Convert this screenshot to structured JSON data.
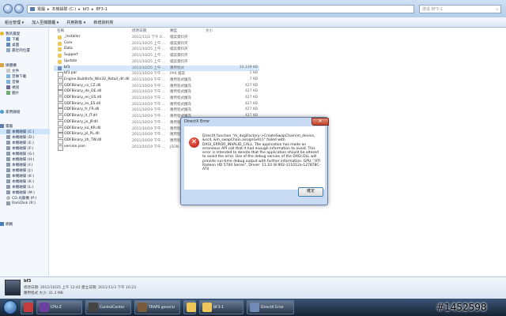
{
  "address_bar": {
    "crumbs": [
      "電腦",
      "本機磁碟 (C:)",
      "bf3",
      "BF3-1"
    ],
    "search_placeholder": "搜尋 BF3-1"
  },
  "toolbar": {
    "organize": "組合管理 ▾",
    "include_library": "加入至媒體櫃 ▾",
    "share": "共用對象 ▾",
    "new_folder": "新增資料夾"
  },
  "sidebar": {
    "favorites_header": "我的最愛",
    "favorites": [
      "下載",
      "桌面",
      "最近的位置"
    ],
    "libraries_header": "媒體櫃",
    "libraries": [
      "文件",
      "音樂下載",
      "音樂",
      "視訊",
      "圖片"
    ],
    "homegroup": "家用群組",
    "computer_header": "電腦",
    "drives": [
      "本機磁碟 (C:)",
      "本機磁碟 (D:)",
      "本機磁碟 (E:)",
      "本機磁碟 (F:)",
      "本機磁碟 (G:)",
      "本機磁碟 (H:)",
      "本機磁碟 (I:)",
      "本機磁碟 (J:)",
      "本機磁碟 (K:)",
      "本機磁碟 (K:)",
      "本機磁碟 (L:)",
      "本機磁碟 (M:)",
      "CD 光碟機 (P:)",
      "RamDisk (R:)"
    ],
    "network": "網路"
  },
  "columns": {
    "name": "名稱",
    "date": "修改日期",
    "type": "類型",
    "size": "大小"
  },
  "files": [
    {
      "name": "_Installer",
      "date": "2011/11/2 下午 0...",
      "type": "檔案資料夾",
      "size": "",
      "kind": "folder"
    },
    {
      "name": "Core",
      "date": "2011/10/25 上午 ...",
      "type": "檔案資料夾",
      "size": "",
      "kind": "folder"
    },
    {
      "name": "Data",
      "date": "2011/10/25 上午 ...",
      "type": "檔案資料夾",
      "size": "",
      "kind": "folder"
    },
    {
      "name": "Support",
      "date": "2011/10/25 上午 ...",
      "type": "檔案資料夾",
      "size": "",
      "kind": "folder"
    },
    {
      "name": "Update",
      "date": "2011/10/25 上午 ...",
      "type": "檔案資料夾",
      "size": "",
      "kind": "folder"
    },
    {
      "name": "bf3",
      "date": "2011/10/25 上午 ...",
      "type": "應用程式",
      "size": "32,139 KB",
      "kind": "exe"
    },
    {
      "name": "bf3.par",
      "date": "2011/10/19 下午 ...",
      "type": "PAR 檔案",
      "size": "1 KB",
      "kind": "file"
    },
    {
      "name": "Engine.BuildInfo_Win32_Retail_dll.dll",
      "date": "2011/10/19 下午 ...",
      "type": "應用程式擴充",
      "size": "7 KB",
      "kind": "file"
    },
    {
      "name": "ODFBinary_cs_CZ.dll",
      "date": "2011/10/19 下午 ...",
      "type": "應用程式擴充",
      "size": "427 KB",
      "kind": "file"
    },
    {
      "name": "ODFBinary_de_DE.dll",
      "date": "2011/10/19 下午 ...",
      "type": "應用程式擴充",
      "size": "427 KB",
      "kind": "file"
    },
    {
      "name": "ODFBinary_en_US.dll",
      "date": "2011/10/19 下午 ...",
      "type": "應用程式擴充",
      "size": "427 KB",
      "kind": "file"
    },
    {
      "name": "ODFBinary_es_ES.dll",
      "date": "2011/10/19 下午 ...",
      "type": "應用程式擴充",
      "size": "427 KB",
      "kind": "file"
    },
    {
      "name": "ODFBinary_fr_FR.dll",
      "date": "2011/10/19 下午 ...",
      "type": "應用程式擴充",
      "size": "427 KB",
      "kind": "file"
    },
    {
      "name": "ODFBinary_it_IT.dll",
      "date": "2011/10/19 下午 ...",
      "type": "應用程式擴充",
      "size": "427 KB",
      "kind": "file"
    },
    {
      "name": "ODFBinary_ja_JP.dll",
      "date": "2011/10/19 下午 ...",
      "type": "應用程式擴充",
      "size": "427 KB",
      "kind": "file"
    },
    {
      "name": "ODFBinary_ko_KR.dll",
      "date": "2011/10/19 下午 ...",
      "type": "應用程式擴充",
      "size": "427 KB",
      "kind": "file"
    },
    {
      "name": "ODFBinary_pl_PL.dll",
      "date": "2011/10/19 下午 ...",
      "type": "應用程式擴充",
      "size": "427 KB",
      "kind": "file"
    },
    {
      "name": "ODFBinary_zh_TW.dll",
      "date": "2011/10/19 下午 ...",
      "type": "應用程式擴充",
      "size": "427 KB",
      "kind": "file"
    },
    {
      "name": "version.json",
      "date": "2011/10/19 下午 ...",
      "type": "JSON 檔案",
      "size": "",
      "kind": "file"
    }
  ],
  "details": {
    "name": "bf3",
    "line1": "修改日期: 2011/10/25 上午 12:42   建立日期: 2011/11/3 下午 10:23",
    "line2": "應用程式      大小: 31.3 MB"
  },
  "dialog": {
    "title": "DirectX Error",
    "close": "✕",
    "message": "DirectX function \"m_dxgiFactory->CreateSwapChain(m_device, &scd, &m_swapChain.assignGet())\" failed with DXGI_ERROR_INVALID_CALL. The application has made an erroneous API call that it had enough information to avoid. This error is intended to denote that the application should be altered to avoid the error. Use of the debug version of the DXGI.DLL will provide run-time debug output with further information. GPU: \"ATI Radeon HD 5700 Series\", Driver: 11.10 (8.902-111012a-127878C-ATI)",
    "ok": "確定"
  },
  "taskbar": {
    "items": [
      "CPU-Z",
      "ControlCenter",
      "TRAPS general",
      "",
      "BF3-1",
      "DirectX Error"
    ]
  },
  "watermark": "#1452598"
}
